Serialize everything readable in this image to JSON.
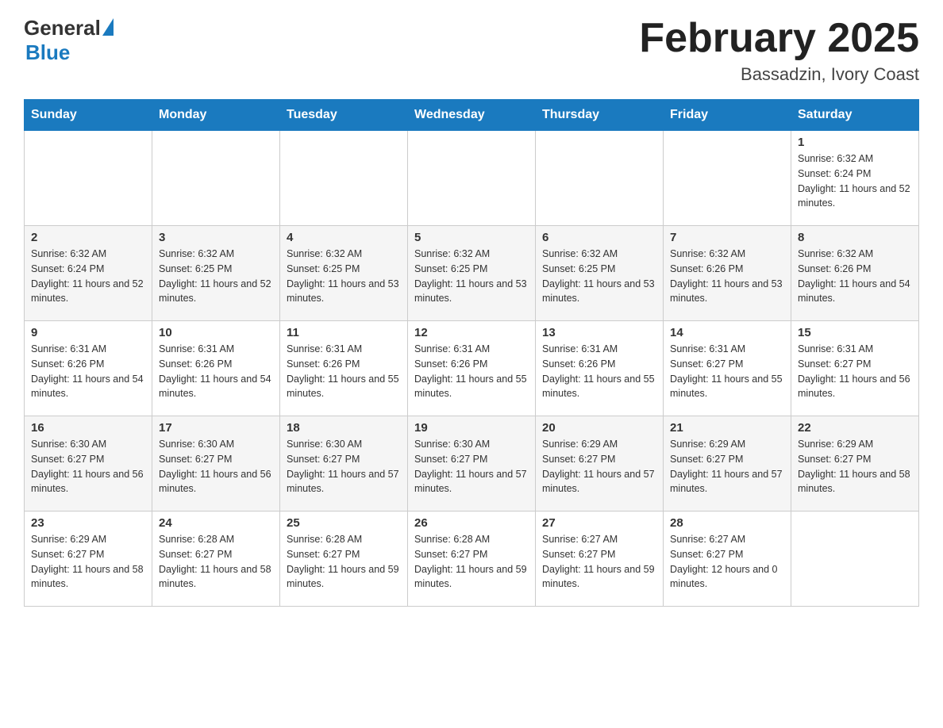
{
  "logo": {
    "general": "General",
    "blue": "Blue"
  },
  "title": {
    "month_year": "February 2025",
    "location": "Bassadzin, Ivory Coast"
  },
  "weekdays": [
    "Sunday",
    "Monday",
    "Tuesday",
    "Wednesday",
    "Thursday",
    "Friday",
    "Saturday"
  ],
  "weeks": [
    [
      {
        "day": "",
        "info": ""
      },
      {
        "day": "",
        "info": ""
      },
      {
        "day": "",
        "info": ""
      },
      {
        "day": "",
        "info": ""
      },
      {
        "day": "",
        "info": ""
      },
      {
        "day": "",
        "info": ""
      },
      {
        "day": "1",
        "info": "Sunrise: 6:32 AM\nSunset: 6:24 PM\nDaylight: 11 hours and 52 minutes."
      }
    ],
    [
      {
        "day": "2",
        "info": "Sunrise: 6:32 AM\nSunset: 6:24 PM\nDaylight: 11 hours and 52 minutes."
      },
      {
        "day": "3",
        "info": "Sunrise: 6:32 AM\nSunset: 6:25 PM\nDaylight: 11 hours and 52 minutes."
      },
      {
        "day": "4",
        "info": "Sunrise: 6:32 AM\nSunset: 6:25 PM\nDaylight: 11 hours and 53 minutes."
      },
      {
        "day": "5",
        "info": "Sunrise: 6:32 AM\nSunset: 6:25 PM\nDaylight: 11 hours and 53 minutes."
      },
      {
        "day": "6",
        "info": "Sunrise: 6:32 AM\nSunset: 6:25 PM\nDaylight: 11 hours and 53 minutes."
      },
      {
        "day": "7",
        "info": "Sunrise: 6:32 AM\nSunset: 6:26 PM\nDaylight: 11 hours and 53 minutes."
      },
      {
        "day": "8",
        "info": "Sunrise: 6:32 AM\nSunset: 6:26 PM\nDaylight: 11 hours and 54 minutes."
      }
    ],
    [
      {
        "day": "9",
        "info": "Sunrise: 6:31 AM\nSunset: 6:26 PM\nDaylight: 11 hours and 54 minutes."
      },
      {
        "day": "10",
        "info": "Sunrise: 6:31 AM\nSunset: 6:26 PM\nDaylight: 11 hours and 54 minutes."
      },
      {
        "day": "11",
        "info": "Sunrise: 6:31 AM\nSunset: 6:26 PM\nDaylight: 11 hours and 55 minutes."
      },
      {
        "day": "12",
        "info": "Sunrise: 6:31 AM\nSunset: 6:26 PM\nDaylight: 11 hours and 55 minutes."
      },
      {
        "day": "13",
        "info": "Sunrise: 6:31 AM\nSunset: 6:26 PM\nDaylight: 11 hours and 55 minutes."
      },
      {
        "day": "14",
        "info": "Sunrise: 6:31 AM\nSunset: 6:27 PM\nDaylight: 11 hours and 55 minutes."
      },
      {
        "day": "15",
        "info": "Sunrise: 6:31 AM\nSunset: 6:27 PM\nDaylight: 11 hours and 56 minutes."
      }
    ],
    [
      {
        "day": "16",
        "info": "Sunrise: 6:30 AM\nSunset: 6:27 PM\nDaylight: 11 hours and 56 minutes."
      },
      {
        "day": "17",
        "info": "Sunrise: 6:30 AM\nSunset: 6:27 PM\nDaylight: 11 hours and 56 minutes."
      },
      {
        "day": "18",
        "info": "Sunrise: 6:30 AM\nSunset: 6:27 PM\nDaylight: 11 hours and 57 minutes."
      },
      {
        "day": "19",
        "info": "Sunrise: 6:30 AM\nSunset: 6:27 PM\nDaylight: 11 hours and 57 minutes."
      },
      {
        "day": "20",
        "info": "Sunrise: 6:29 AM\nSunset: 6:27 PM\nDaylight: 11 hours and 57 minutes."
      },
      {
        "day": "21",
        "info": "Sunrise: 6:29 AM\nSunset: 6:27 PM\nDaylight: 11 hours and 57 minutes."
      },
      {
        "day": "22",
        "info": "Sunrise: 6:29 AM\nSunset: 6:27 PM\nDaylight: 11 hours and 58 minutes."
      }
    ],
    [
      {
        "day": "23",
        "info": "Sunrise: 6:29 AM\nSunset: 6:27 PM\nDaylight: 11 hours and 58 minutes."
      },
      {
        "day": "24",
        "info": "Sunrise: 6:28 AM\nSunset: 6:27 PM\nDaylight: 11 hours and 58 minutes."
      },
      {
        "day": "25",
        "info": "Sunrise: 6:28 AM\nSunset: 6:27 PM\nDaylight: 11 hours and 59 minutes."
      },
      {
        "day": "26",
        "info": "Sunrise: 6:28 AM\nSunset: 6:27 PM\nDaylight: 11 hours and 59 minutes."
      },
      {
        "day": "27",
        "info": "Sunrise: 6:27 AM\nSunset: 6:27 PM\nDaylight: 11 hours and 59 minutes."
      },
      {
        "day": "28",
        "info": "Sunrise: 6:27 AM\nSunset: 6:27 PM\nDaylight: 12 hours and 0 minutes."
      },
      {
        "day": "",
        "info": ""
      }
    ]
  ]
}
